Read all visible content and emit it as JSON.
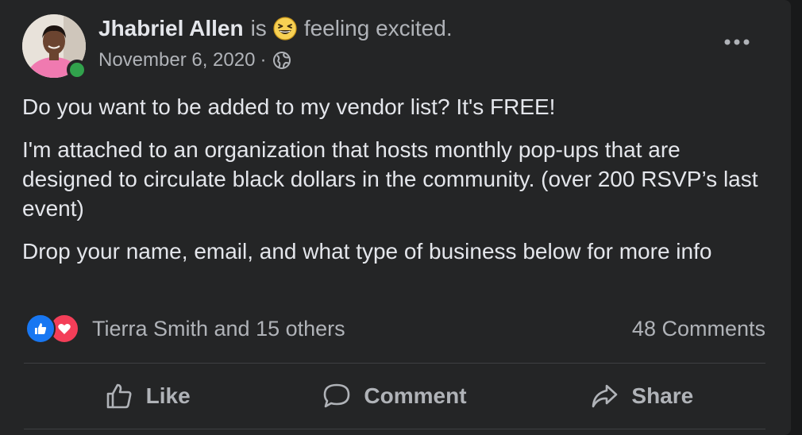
{
  "post": {
    "author": "Jhabriel Allen",
    "feeling_prefix": "is",
    "feeling_text": "feeling excited.",
    "date": "November 6, 2020",
    "separator": "·",
    "paragraphs": [
      "Do you want to be added to my vendor list? It's FREE!",
      "I'm attached to an organization that hosts monthly pop-ups that are designed to circulate black dollars in the community. (over 200 RSVP’s last event)",
      "Drop your name, email, and what type of business below for more info"
    ]
  },
  "reactions": {
    "names": "Tierra Smith and 15 others",
    "comments": "48 Comments",
    "icons": [
      "like-icon",
      "love-icon"
    ]
  },
  "actions": {
    "like": "Like",
    "comment": "Comment",
    "share": "Share"
  },
  "icons": {
    "globe": "globe-icon",
    "more": "more-horizontal-icon",
    "feeling_emoji": "grinning-squinting-emoji"
  },
  "colors": {
    "card_bg": "#242526",
    "page_bg": "#18191a",
    "primary_text": "#e4e6eb",
    "secondary_text": "#b0b3b8",
    "like_blue": "#1877f2",
    "love_red": "#f33e58",
    "online_green": "#31a24c"
  }
}
